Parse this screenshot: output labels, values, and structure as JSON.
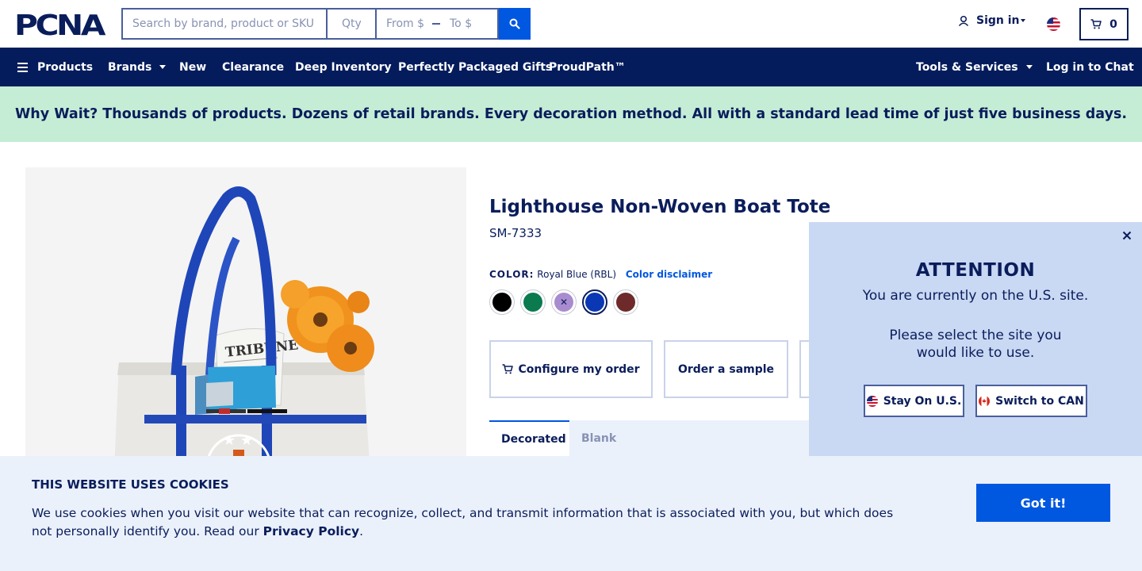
{
  "header": {
    "logo_text": "PCNA",
    "search_placeholder": "Search by brand, product or SKU",
    "qty_placeholder": "Qty",
    "price_from_placeholder": "From $",
    "price_to_placeholder": "To $",
    "signin_label": "Sign in",
    "cart_count": "0"
  },
  "nav": {
    "products": "Products",
    "brands": "Brands",
    "new": "New",
    "clearance": "Clearance",
    "deep_inventory": "Deep Inventory",
    "gifts": "Perfectly Packaged Gifts",
    "proudpath": "ProudPath™",
    "tools": "Tools & Services",
    "chat": "Log in to Chat"
  },
  "promo": {
    "text": "Why Wait? Thousands of products. Dozens of retail brands. Every decoration method. All with a standard lead time of just five business days."
  },
  "product": {
    "title": "Lighthouse Non-Woven Boat Tote",
    "sku": "SM-7333",
    "color_label": "COLOR:",
    "color_value": "Royal Blue (RBL)",
    "color_disclaimer": "Color disclaimer",
    "swatches": [
      {
        "name": "Black",
        "hex": "#000000"
      },
      {
        "name": "Green",
        "hex": "#0b7a4f"
      },
      {
        "name": "Purple",
        "hex": "#a98ccf",
        "unavailable": true
      },
      {
        "name": "Royal Blue",
        "hex": "#0a37b4",
        "selected": true
      },
      {
        "name": "Maroon",
        "hex": "#6e2a2a"
      }
    ],
    "configure_label": "Configure my order",
    "sample_label": "Order a sample",
    "tabs": [
      "Decorated",
      "Blank"
    ]
  },
  "attention": {
    "title": "ATTENTION",
    "line1": "You are currently on the U.S. site.",
    "line2": "Please select the site you would like to use.",
    "stay_label": "Stay On U.S.",
    "switch_label": "Switch to CAN"
  },
  "cookies": {
    "title": "THIS WEBSITE USES COOKIES",
    "text": "We use cookies when you visit our website that can recognize, collect, and transmit information that is associated with you, but which does not personally identify you. Read our",
    "policy_link": "Privacy Policy",
    "button": "Got it!"
  },
  "colors": {
    "navy": "#041c5c",
    "accent_blue": "#0057e0",
    "promo_green": "#c5edd6",
    "modal_bg": "#c9d8f3",
    "cookie_bg": "#ebf1fb"
  }
}
